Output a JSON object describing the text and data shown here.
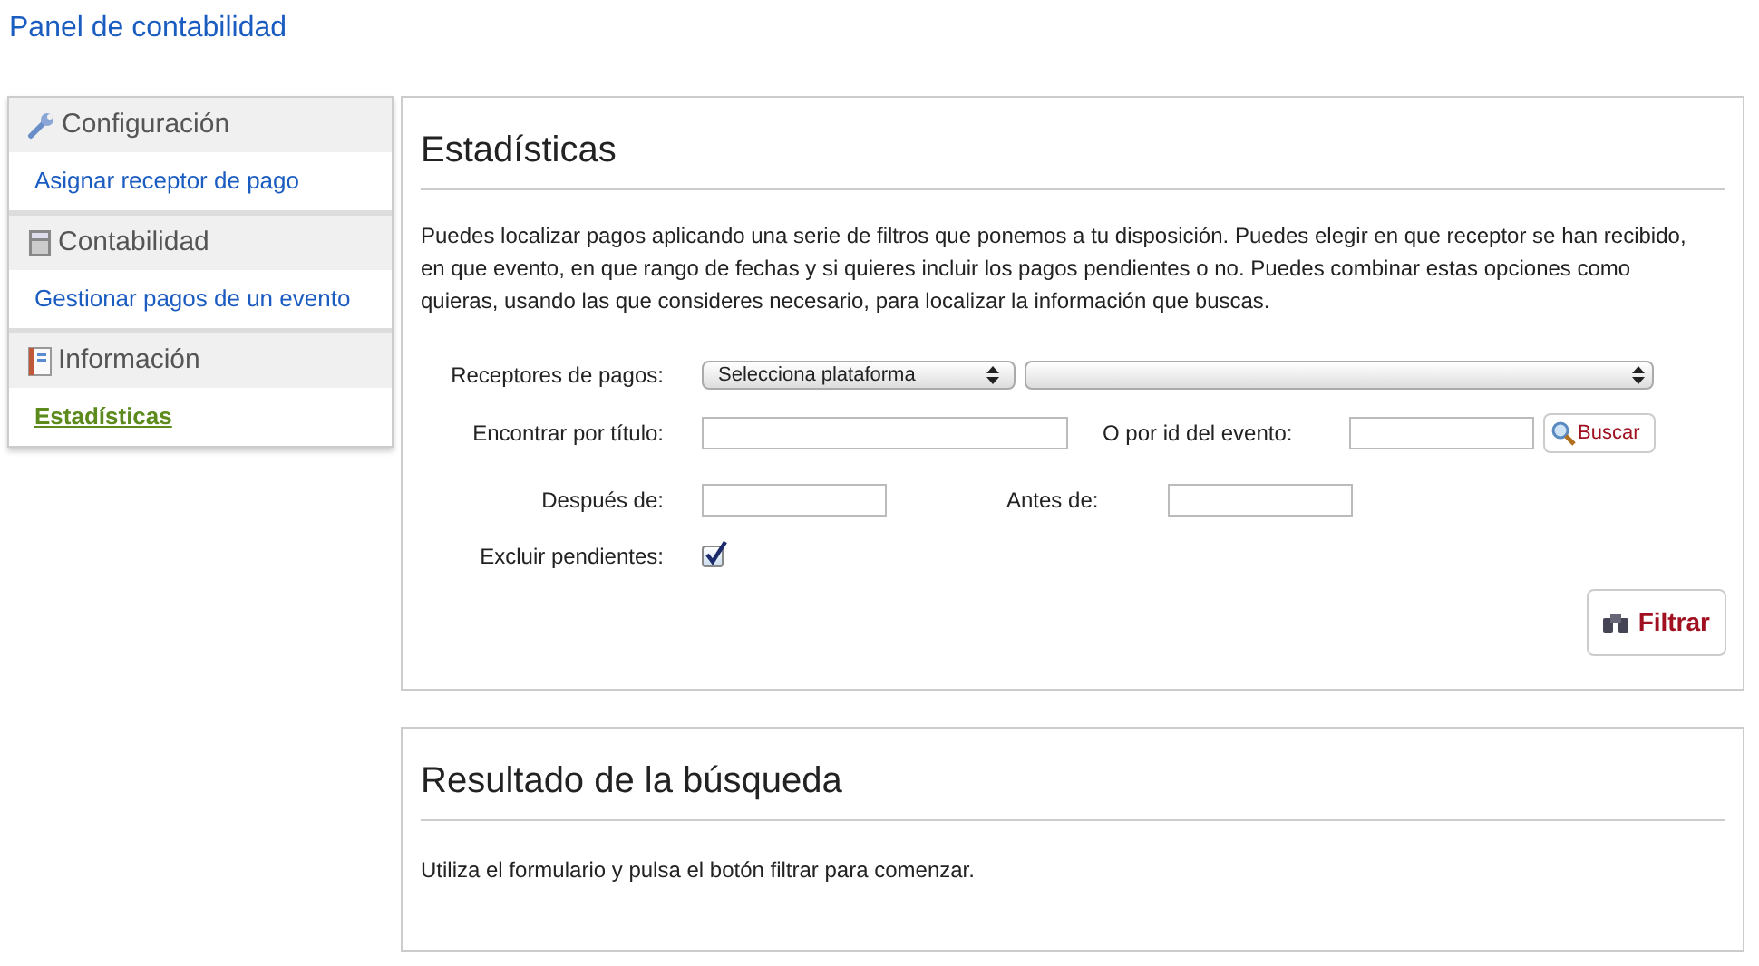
{
  "page_title": "Panel de contabilidad",
  "sidebar": [
    {
      "title": "Configuración",
      "items": [
        {
          "label": "Asignar receptor de pago",
          "selected": false
        }
      ]
    },
    {
      "title": "Contabilidad",
      "items": [
        {
          "label": "Gestionar pagos de un evento",
          "selected": false
        }
      ]
    },
    {
      "title": "Información",
      "items": [
        {
          "label": "Estadísticas",
          "selected": true
        }
      ]
    }
  ],
  "stats_panel": {
    "title": "Estadísticas",
    "description": "Puedes localizar pagos aplicando una serie de filtros que ponemos a tu disposición. Puedes elegir en que receptor se han recibido, en que evento, en que rango de fechas y si quieres incluir los pagos pendientes o no. Puedes combinar estas opciones como quieras, usando las que consideres necesario, para localizar la información que buscas.",
    "receivers_label": "Receptores de pagos:",
    "platform_select": "Selecciona plataforma",
    "title_label": "Encontrar por título:",
    "id_label": "O por id del evento:",
    "search_button": "Buscar",
    "after_label": "Después de:",
    "before_label": "Antes de:",
    "exclude_label": "Excluir pendientes:",
    "exclude_checked": true,
    "filter_button": "Filtrar"
  },
  "results_panel": {
    "title": "Resultado de la búsqueda",
    "message": "Utiliza el formulario y pulsa el botón filtrar para comenzar."
  }
}
